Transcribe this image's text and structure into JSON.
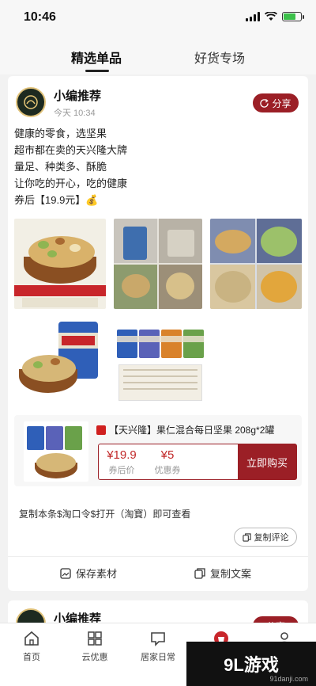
{
  "status_bar": {
    "time": "10:46"
  },
  "top_tabs": [
    {
      "label": "精选单品",
      "active": true
    },
    {
      "label": "好货专场",
      "active": false
    }
  ],
  "post": {
    "author": "小编推荐",
    "time": "今天 10:34",
    "share_label": "分享",
    "lines": [
      "健康的零食，选坚果",
      "超市都在卖的天兴隆大牌",
      "量足、种类多、酥脆",
      "让你吃的开心，吃的健康",
      "券后【19.9元】💰"
    ],
    "product": {
      "title": "【天兴隆】果仁混合每日坚果 208g*2罐",
      "final_price": "¥19.9",
      "final_price_label": "券后价",
      "coupon_value": "¥5",
      "coupon_label": "优惠券",
      "buy_label": "立即购买"
    },
    "copy_text": "复制本条$淘口令$打开（淘寶）即可查看",
    "copy_comment_label": "复制评论",
    "save_material_label": "保存素材",
    "copy_copy_label": "复制文案"
  },
  "next_post": {
    "author": "小编推荐",
    "share_label": "分享"
  },
  "bottom_nav": [
    {
      "label": "首页",
      "icon": "home-icon"
    },
    {
      "label": "云优惠",
      "icon": "grid-icon"
    },
    {
      "label": "居家日常",
      "icon": "message-icon"
    },
    {
      "label": "",
      "icon": "bag-icon"
    },
    {
      "label": "",
      "icon": "user-icon"
    }
  ],
  "watermark": {
    "text": "9L游戏",
    "url": "91danji.com"
  },
  "colors": {
    "accent": "#9b1f26",
    "price": "#c22a2a"
  }
}
